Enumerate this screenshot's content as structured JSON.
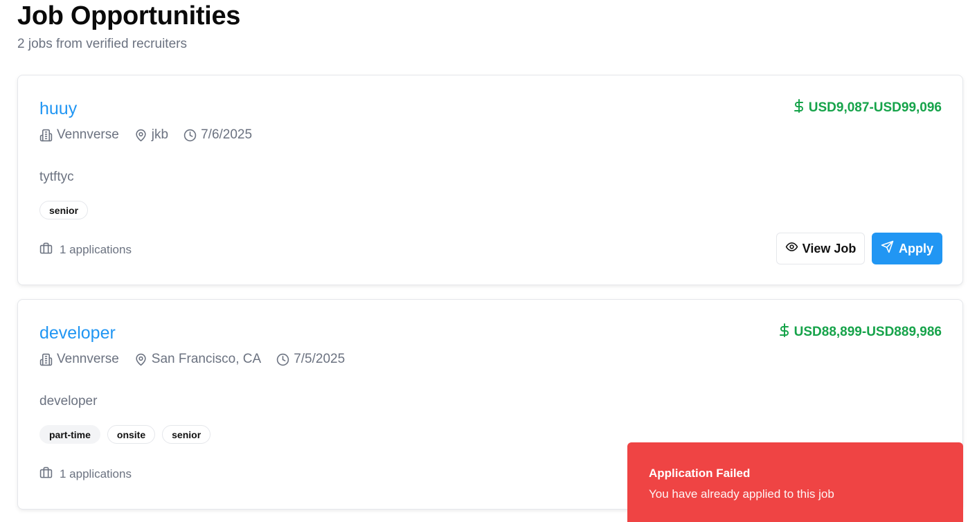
{
  "header": {
    "title": "Job Opportunities",
    "subtitle": "2 jobs from verified recruiters"
  },
  "jobs": [
    {
      "title": "huuy",
      "salary": "USD9,087-USD99,096",
      "company": "Vennverse",
      "location": "jkb",
      "date": "7/6/2025",
      "description": "tytftyc",
      "tags": [
        "senior"
      ],
      "applications": "1 applications",
      "view_label": "View Job",
      "apply_label": "Apply"
    },
    {
      "title": "developer",
      "salary": "USD88,899-USD889,986",
      "company": "Vennverse",
      "location": "San Francisco, CA",
      "date": "7/5/2025",
      "description": "developer",
      "tags": [
        "part-time",
        "onsite",
        "senior"
      ],
      "applications": "1 applications"
    }
  ],
  "toast": {
    "title": "Application Failed",
    "message": "You have already applied to this job"
  },
  "colors": {
    "accent": "#2196f3",
    "salary": "#16a34a",
    "toast": "#ef4444"
  }
}
